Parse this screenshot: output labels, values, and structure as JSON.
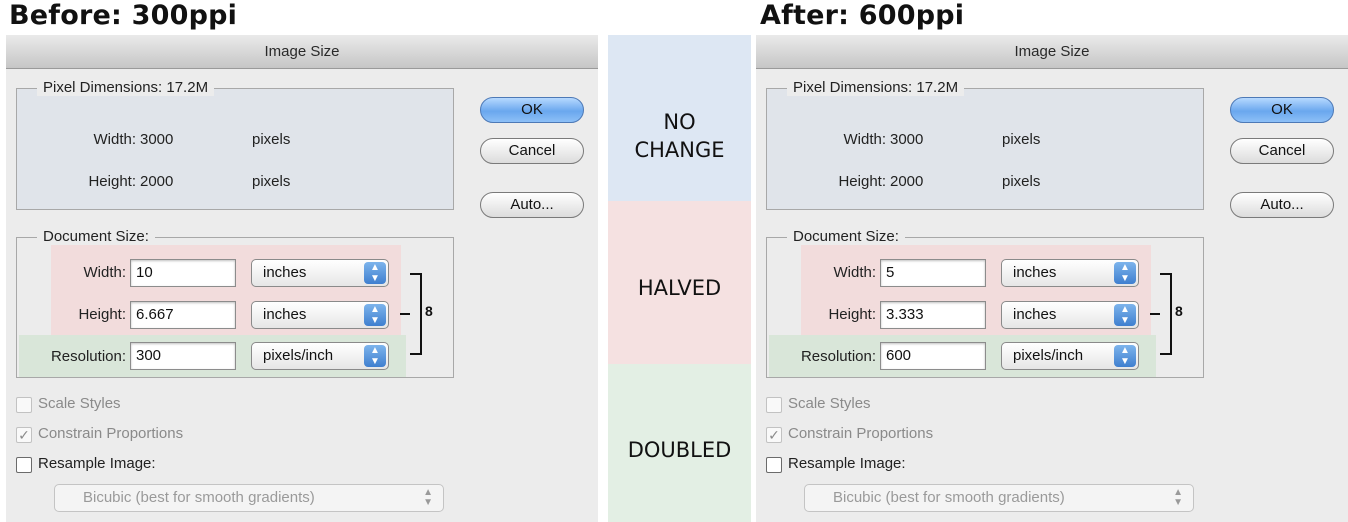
{
  "left": {
    "heading": "Before: 300ppi",
    "window_title": "Image Size",
    "pixel_dimensions": {
      "legend": "Pixel Dimensions:  17.2M",
      "width_label": "Width:",
      "width_value": "3000",
      "width_unit": "pixels",
      "height_label": "Height:",
      "height_value": "2000",
      "height_unit": "pixels"
    },
    "document_size": {
      "legend": "Document Size:",
      "width_label": "Width:",
      "width_value": "10",
      "width_unit": "inches",
      "height_label": "Height:",
      "height_value": "6.667",
      "height_unit": "inches",
      "resolution_label": "Resolution:",
      "resolution_value": "300",
      "resolution_unit": "pixels/inch"
    },
    "buttons": {
      "ok": "OK",
      "cancel": "Cancel",
      "auto": "Auto..."
    },
    "options": {
      "scale_styles": "Scale Styles",
      "constrain": "Constrain Proportions",
      "resample": "Resample Image:",
      "method": "Bicubic (best for smooth gradients)"
    }
  },
  "right": {
    "heading": "After: 600ppi",
    "window_title": "Image Size",
    "pixel_dimensions": {
      "legend": "Pixel Dimensions:  17.2M",
      "width_label": "Width:",
      "width_value": "3000",
      "width_unit": "pixels",
      "height_label": "Height:",
      "height_value": "2000",
      "height_unit": "pixels"
    },
    "document_size": {
      "legend": "Document Size:",
      "width_label": "Width:",
      "width_value": "5",
      "width_unit": "inches",
      "height_label": "Height:",
      "height_value": "3.333",
      "height_unit": "inches",
      "resolution_label": "Resolution:",
      "resolution_value": "600",
      "resolution_unit": "pixels/inch"
    },
    "buttons": {
      "ok": "OK",
      "cancel": "Cancel",
      "auto": "Auto..."
    },
    "options": {
      "scale_styles": "Scale Styles",
      "constrain": "Constrain Proportions",
      "resample": "Resample Image:",
      "method": "Bicubic (best for smooth gradients)"
    }
  },
  "comparison": {
    "no_change_line1": "NO",
    "no_change_line2": "CHANGE",
    "halved": "HALVED",
    "doubled": "DOUBLED"
  },
  "colors": {
    "pixel_band": "#dde7f3",
    "document_band": "#f5e1e1",
    "resolution_band": "#e3efe4"
  },
  "icons": {
    "checkmark": "✓",
    "popup_arrows": "▲▼",
    "chain_link": "chain-link-icon"
  }
}
